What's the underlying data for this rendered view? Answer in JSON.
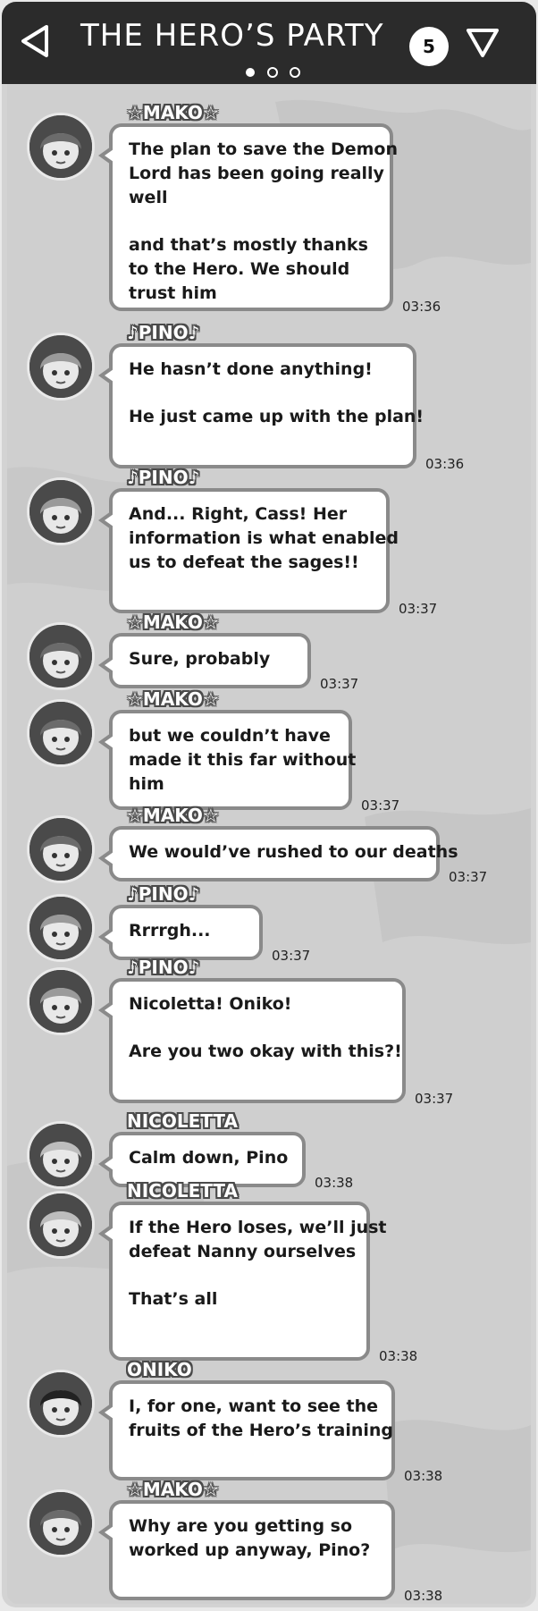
{
  "header": {
    "title": "THE HERO’S PARTY",
    "member_count": "5",
    "back_icon": "back-arrow-icon",
    "menu_icon": "dropdown-triangle-icon",
    "page_dots": 3,
    "active_dot": 1
  },
  "messages": [
    {
      "sender": "☆MAKO☆",
      "avatar": "mako",
      "paragraphs": [
        [
          "The plan to save the Demon",
          "Lord has been going really",
          "well"
        ],
        [
          "and that’s mostly thanks",
          "to the Hero. We should",
          "trust him"
        ]
      ],
      "time": "03:36"
    },
    {
      "sender": "♪PINO♪",
      "avatar": "pino",
      "paragraphs": [
        [
          "He hasn’t done anything!"
        ],
        [
          "He just came up with the plan!"
        ]
      ],
      "time": "03:36"
    },
    {
      "sender": "♪PINO♪",
      "avatar": "pino",
      "paragraphs": [
        [
          "And... Right, Cass! Her",
          "information is what enabled",
          "us to defeat the sages!!"
        ]
      ],
      "time": "03:37"
    },
    {
      "sender": "☆MAKO☆",
      "avatar": "mako",
      "paragraphs": [
        [
          "Sure, probably"
        ]
      ],
      "time": "03:37"
    },
    {
      "sender": "☆MAKO☆",
      "avatar": "mako",
      "paragraphs": [
        [
          "but we couldn’t have",
          "made it this far without",
          "him"
        ]
      ],
      "time": "03:37"
    },
    {
      "sender": "☆MAKO☆",
      "avatar": "mako",
      "paragraphs": [
        [
          "We would’ve rushed to our deaths"
        ]
      ],
      "time": "03:37"
    },
    {
      "sender": "♪PINO♪",
      "avatar": "pino",
      "paragraphs": [
        [
          "Rrrrgh..."
        ]
      ],
      "time": "03:37"
    },
    {
      "sender": "♪PINO♪",
      "avatar": "pino",
      "paragraphs": [
        [
          "Nicoletta! Oniko!"
        ],
        [
          "Are you two okay with this?!"
        ]
      ],
      "time": "03:37"
    },
    {
      "sender": "NICOLETTA",
      "avatar": "nicoletta",
      "paragraphs": [
        [
          "Calm down, Pino"
        ]
      ],
      "time": "03:38"
    },
    {
      "sender": "NICOLETTA",
      "avatar": "nicoletta",
      "paragraphs": [
        [
          "If the Hero loses, we’ll just",
          "defeat Nanny ourselves"
        ],
        [
          "That’s all"
        ]
      ],
      "time": "03:38"
    },
    {
      "sender": "ONIKO",
      "avatar": "oniko",
      "paragraphs": [
        [
          "I, for one, want to see the",
          "fruits of the Hero’s training"
        ]
      ],
      "time": "03:38"
    },
    {
      "sender": "☆MAKO☆",
      "avatar": "mako",
      "paragraphs": [
        [
          "Why are you getting so",
          "worked up anyway, Pino?"
        ]
      ],
      "time": "03:38"
    }
  ]
}
